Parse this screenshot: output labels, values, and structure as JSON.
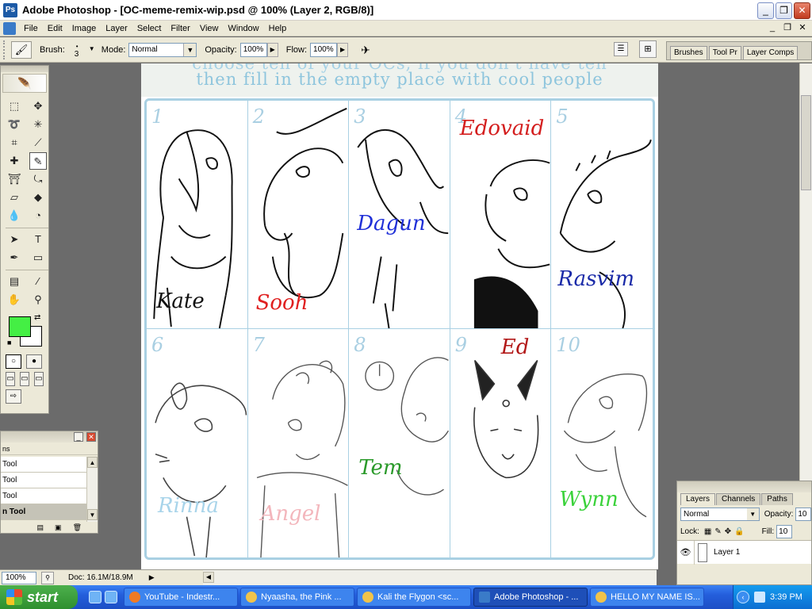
{
  "window": {
    "title": "Adobe Photoshop - [OC-meme-remix-wip.psd @ 100% (Layer 2, RGB/8)]",
    "buttons": {
      "minimize": "_",
      "maximize": "❐",
      "close": "✕"
    }
  },
  "menubar": {
    "items": [
      "File",
      "Edit",
      "Image",
      "Layer",
      "Select",
      "Filter",
      "View",
      "Window",
      "Help"
    ],
    "doc_buttons": [
      "_",
      "❐",
      "✕"
    ]
  },
  "options_bar": {
    "brush_label": "Brush:",
    "brush_size": "3",
    "mode_label": "Mode:",
    "mode_value": "Normal",
    "opacity_label": "Opacity:",
    "opacity_value": "100%",
    "flow_label": "Flow:",
    "flow_value": "100%"
  },
  "palette_well": {
    "tabs": [
      "Brushes",
      "Tool Pr",
      "Layer Comps"
    ]
  },
  "toolbox": {
    "foreground_color": "#44ef44",
    "background_color": "#ffffff"
  },
  "tool_presets": {
    "tab": "ns",
    "items": [
      "Tool",
      "Tool",
      "Tool",
      "n Tool"
    ],
    "selected_index": 3
  },
  "canvas": {
    "header_line1": "choose ten of your OCs, if you don't have ten",
    "header_line2": "then fill in the empty place with cool people",
    "cells": [
      {
        "num": "1",
        "name": "Kate",
        "color": "#111111"
      },
      {
        "num": "2",
        "name": "Sooh",
        "color": "#e02020"
      },
      {
        "num": "3",
        "name": "Dagun",
        "color": "#2030d8"
      },
      {
        "num": "4",
        "name": "Edovaid",
        "color": "#d41e1e"
      },
      {
        "num": "5",
        "name": "Rasvim",
        "color": "#1a2aa8"
      },
      {
        "num": "6",
        "name": "Rinna",
        "color": "#a8d4ea"
      },
      {
        "num": "7",
        "name": "Angel",
        "color": "#f3b6bc"
      },
      {
        "num": "8",
        "name": "Tem",
        "color": "#2a9a2a"
      },
      {
        "num": "9",
        "name": "Ed",
        "color": "#b21818"
      },
      {
        "num": "10",
        "name": "Wynn",
        "color": "#3ad23a"
      }
    ]
  },
  "layers_panel": {
    "tabs": [
      "Layers",
      "Channels",
      "Paths"
    ],
    "blend_mode": "Normal",
    "opacity_label": "Opacity:",
    "opacity_value": "10",
    "lock_label": "Lock:",
    "fill_label": "Fill:",
    "fill_value": "10",
    "layer_name": "Layer 1"
  },
  "statusbar": {
    "zoom": "100%",
    "doc_info": "Doc: 16.1M/18.9M"
  },
  "taskbar": {
    "start_label": "start",
    "tasks": [
      {
        "label": "YouTube - Indestr...",
        "icon": "firefox-icon"
      },
      {
        "label": "Nyaasha, the Pink ...",
        "icon": "browser-icon"
      },
      {
        "label": "Kali the Flygon <sc...",
        "icon": "browser-icon"
      },
      {
        "label": "Adobe Photoshop - ...",
        "icon": "photoshop-icon"
      },
      {
        "label": "HELLO MY NAME IS...",
        "icon": "browser-icon"
      }
    ],
    "active_index": 3,
    "clock": "3:39 PM"
  }
}
